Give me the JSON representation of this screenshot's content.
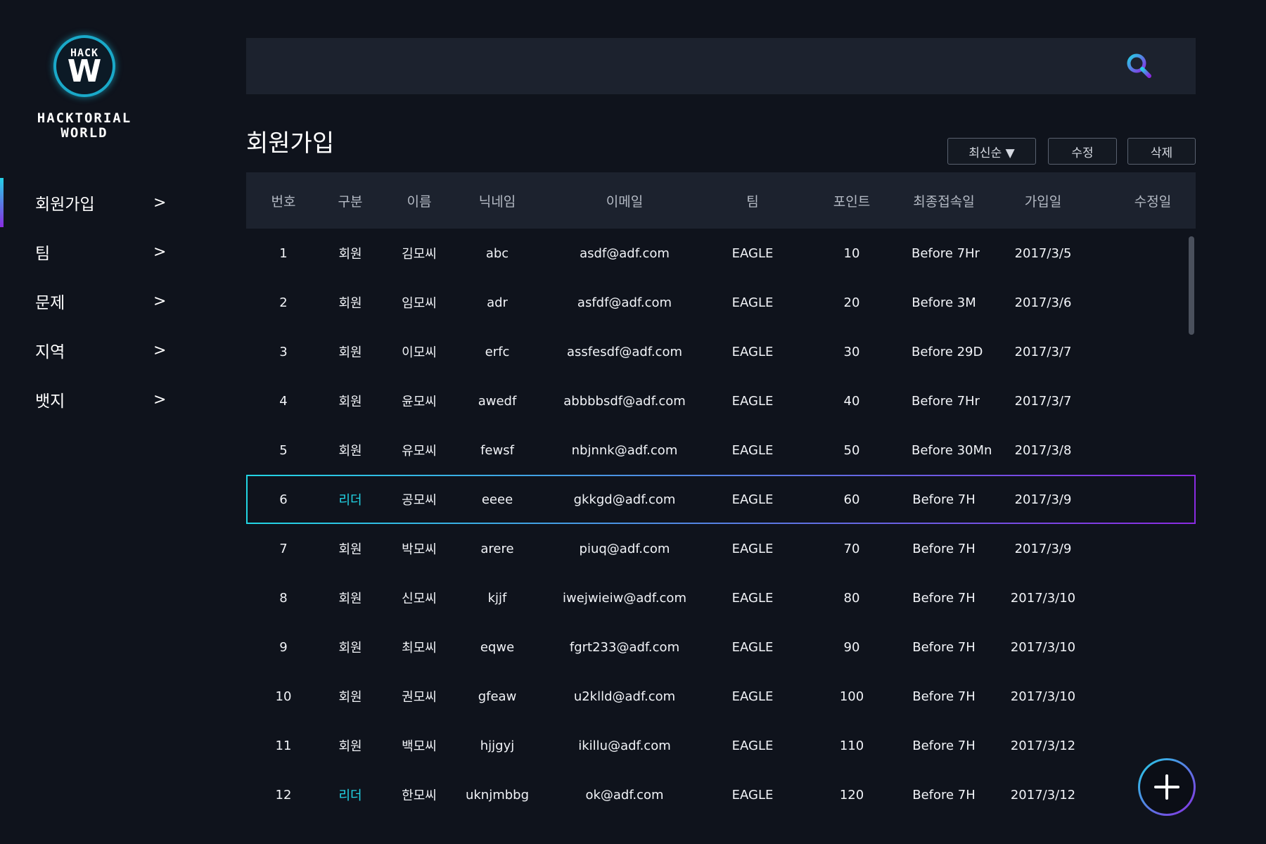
{
  "brand": {
    "logo_top": "HACK",
    "logo_letter": "W",
    "name_line1": "HACKTORIAL",
    "name_line2": "WORLD"
  },
  "sidebar": {
    "items": [
      {
        "label": "회원가입",
        "chevron": ">"
      },
      {
        "label": "팀",
        "chevron": ">"
      },
      {
        "label": "문제",
        "chevron": ">"
      },
      {
        "label": "지역",
        "chevron": ">"
      },
      {
        "label": "뱃지",
        "chevron": ">"
      }
    ],
    "active_index": 0
  },
  "search": {
    "value": "",
    "placeholder": ""
  },
  "page": {
    "title": "회원가입"
  },
  "toolbar": {
    "sort_label": "최신순 ▼",
    "edit_label": "수정",
    "delete_label": "삭제"
  },
  "table": {
    "headers": [
      "번호",
      "구분",
      "이름",
      "닉네임",
      "이메일",
      "팀",
      "포인트",
      "최종접속일",
      "가입일",
      "수정일"
    ],
    "rows": [
      [
        "1",
        "회원",
        "김모씨",
        "abc",
        "asdf@adf.com",
        "EAGLE",
        "10",
        "Before 7Hr",
        "2017/3/5",
        ""
      ],
      [
        "2",
        "회원",
        "임모씨",
        "adr",
        "asfdf@adf.com",
        "EAGLE",
        "20",
        "Before 3M",
        "2017/3/6",
        ""
      ],
      [
        "3",
        "회원",
        "이모씨",
        "erfc",
        "assfesdf@adf.com",
        "EAGLE",
        "30",
        "Before 29D",
        "2017/3/7",
        ""
      ],
      [
        "4",
        "회원",
        "윤모씨",
        "awedf",
        "abbbbsdf@adf.com",
        "EAGLE",
        "40",
        "Before 7Hr",
        "2017/3/7",
        ""
      ],
      [
        "5",
        "회원",
        "유모씨",
        "fewsf",
        "nbjnnk@adf.com",
        "EAGLE",
        "50",
        "Before 30Mn",
        "2017/3/8",
        ""
      ],
      [
        "6",
        "리더",
        "공모씨",
        "eeee",
        "gkkgd@adf.com",
        "EAGLE",
        "60",
        "Before 7H",
        "2017/3/9",
        ""
      ],
      [
        "7",
        "회원",
        "박모씨",
        "arere",
        "piuq@adf.com",
        "EAGLE",
        "70",
        "Before 7H",
        "2017/3/9",
        ""
      ],
      [
        "8",
        "회원",
        "신모씨",
        "kjjf",
        "iwejwieiw@adf.com",
        "EAGLE",
        "80",
        "Before 7H",
        "2017/3/10",
        ""
      ],
      [
        "9",
        "회원",
        "최모씨",
        "eqwe",
        "fgrt233@adf.com",
        "EAGLE",
        "90",
        "Before 7H",
        "2017/3/10",
        ""
      ],
      [
        "10",
        "회원",
        "권모씨",
        "gfeaw",
        "u2klld@adf.com",
        "EAGLE",
        "100",
        "Before 7H",
        "2017/3/10",
        ""
      ],
      [
        "11",
        "회원",
        "백모씨",
        "hjjgyj",
        "ikillu@adf.com",
        "EAGLE",
        "110",
        "Before 7H",
        "2017/3/12",
        ""
      ],
      [
        "12",
        "리더",
        "한모씨",
        "uknjmbbg",
        "ok@adf.com",
        "EAGLE",
        "120",
        "Before 7H",
        "2017/3/12",
        ""
      ]
    ],
    "highlight_row": 5,
    "leader_label": "리더"
  },
  "colors": {
    "background": "#0f131c",
    "panel": "#1c222e",
    "accent_cyan": "#22d5e6",
    "accent_purple": "#8a2be2"
  },
  "icons": {
    "search": "search-icon",
    "add": "plus-icon",
    "logo": "hack-w-logo"
  }
}
